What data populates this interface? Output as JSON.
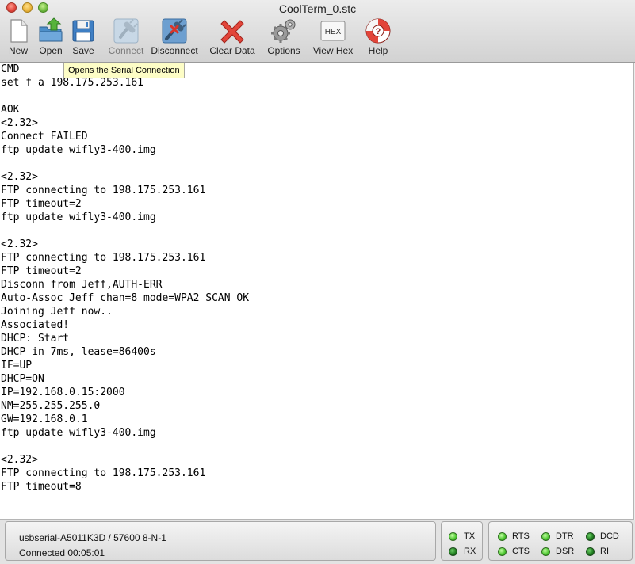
{
  "window": {
    "title": "CoolTerm_0.stc"
  },
  "toolbar": {
    "items": [
      {
        "label": "New",
        "icon": "new-document-icon"
      },
      {
        "label": "Open",
        "icon": "open-folder-icon"
      },
      {
        "label": "Save",
        "icon": "save-disk-icon"
      },
      {
        "label": "Connect",
        "icon": "connect-plug-icon",
        "state": "disabled"
      },
      {
        "label": "Disconnect",
        "icon": "disconnect-plug-icon"
      },
      {
        "label": "Clear Data",
        "icon": "clear-x-icon"
      },
      {
        "label": "Options",
        "icon": "options-gears-icon"
      },
      {
        "label": "View Hex",
        "icon": "hex-icon",
        "icon_text": "HEX"
      },
      {
        "label": "Help",
        "icon": "lifebuoy-help-icon"
      }
    ]
  },
  "tooltip": "Opens the Serial Connection",
  "terminal": {
    "lines": [
      "CMD",
      "set f a 198.175.253.161",
      "",
      "AOK",
      "<2.32>",
      "Connect FAILED",
      "ftp update wifly3-400.img",
      "",
      "<2.32>",
      "FTP connecting to 198.175.253.161",
      "FTP timeout=2",
      "ftp update wifly3-400.img",
      "",
      "<2.32>",
      "FTP connecting to 198.175.253.161",
      "FTP timeout=2",
      "Disconn from Jeff,AUTH-ERR",
      "Auto-Assoc Jeff chan=8 mode=WPA2 SCAN OK",
      "Joining Jeff now..",
      "Associated!",
      "DHCP: Start",
      "DHCP in 7ms, lease=86400s",
      "IF=UP",
      "DHCP=ON",
      "IP=192.168.0.15:2000",
      "NM=255.255.255.0",
      "GW=192.168.0.1",
      "ftp update wifly3-400.img",
      "",
      "<2.32>",
      "FTP connecting to 198.175.253.161",
      "FTP timeout=8"
    ]
  },
  "status": {
    "port": "usbserial-A5011K3D / 57600 8-N-1",
    "connection": "Connected 00:05:01",
    "indicators": {
      "tx": "TX",
      "rx": "RX",
      "rts": "RTS",
      "cts": "CTS",
      "dtr": "DTR",
      "dsr": "DSR",
      "dcd": "DCD",
      "ri": "RI"
    }
  },
  "colors": {
    "led_on": "#48c52c",
    "led_off": "#1d7a1d",
    "tooltip_bg": "#fdfdc6",
    "clear_red": "#d9352a"
  }
}
